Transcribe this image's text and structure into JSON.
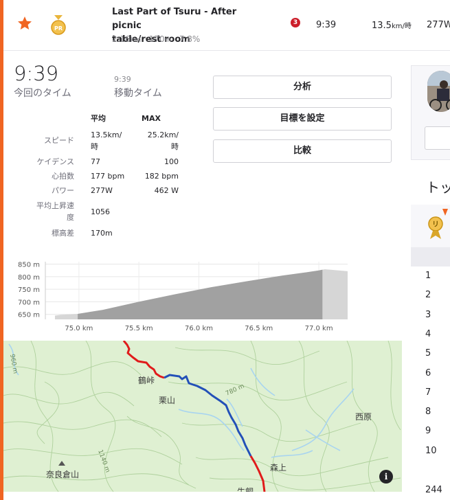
{
  "segment": {
    "name_line1": "Last Part of Tsuru - After picnic",
    "name_line2": "table/rest room",
    "distance": "2.16",
    "distance_unit": "km",
    "elev": "170",
    "elev_unit": "m",
    "grade": "7.8%",
    "rank": "3",
    "time": "9:39",
    "speed": "13.5",
    "speed_unit": "km/時",
    "power": "277W"
  },
  "summary": {
    "time": "9:39",
    "time_label": "今回のタイム",
    "moving_time": "9:39",
    "moving_time_label": "移動タイム"
  },
  "buttons": {
    "analyze": "分析",
    "goal": "目標を設定",
    "compare": "比較"
  },
  "stats": {
    "header_avg": "平均",
    "header_max": "MAX",
    "speed_label": "スピード",
    "speed_avg_1": "13.5km/",
    "speed_avg_2": "時",
    "speed_max_1": "25.2km/",
    "speed_max_2": "時",
    "cadence_label": "ケイデンス",
    "cadence_avg": "77",
    "cadence_max": "100",
    "hr_label": "心拍数",
    "hr_avg": "177 bpm",
    "hr_max": "182 bpm",
    "power_label": "パワー",
    "power_avg": "277W",
    "power_max": "462 W",
    "vam_label_1": "平均上昇速",
    "vam_label_2": "度",
    "vam_avg": "1056",
    "elev_label": "標高差",
    "elev_avg": "170m"
  },
  "elevation_chart": {
    "y_ticks": [
      "850 m",
      "800 m",
      "750 m",
      "700 m",
      "650 m"
    ],
    "x_ticks": [
      "75.0 km",
      "75.5 km",
      "76.0 km",
      "76.5 km",
      "77.0 km"
    ]
  },
  "chart_data": {
    "type": "area",
    "x": [
      74.8,
      74.85,
      74.99,
      75.2,
      75.5,
      75.8,
      76.1,
      76.4,
      76.7,
      76.9,
      77.0,
      77.05
    ],
    "y": [
      645,
      648,
      652,
      668,
      700,
      730,
      758,
      782,
      805,
      818,
      825,
      830
    ],
    "highlight_range": [
      74.99,
      77.03
    ],
    "ylim": [
      630,
      860
    ],
    "xlim": [
      74.72,
      77.24
    ],
    "xlabel": "",
    "ylabel": "",
    "grid": true,
    "colors": {
      "fill": "#bdbdbd",
      "highlight": "#8f8f8f"
    }
  },
  "map": {
    "labels": {
      "pass": "鶴峠",
      "kuriyama": "栗山",
      "nishihara": "西原",
      "morikami": "森上",
      "narakurayama": "奈良倉山",
      "contour_780": "780 m",
      "contour_1140": "1140 m",
      "contour_960": "960 m",
      "bottom": "牛飼"
    },
    "info_icon": "i",
    "colors": {
      "route_red": "#e01b1b",
      "route_blue": "#2350b8",
      "terrain": "#dff0d2",
      "water": "#a8d4f0"
    }
  },
  "sidebar": {
    "title": "トッ",
    "ranks": [
      "1",
      "2",
      "3",
      "4",
      "5",
      "6",
      "7",
      "8",
      "9",
      "10"
    ],
    "note": "244"
  },
  "colors": {
    "accent": "#f06522",
    "rank_badge": "#cc1e2a",
    "star": "#f06522"
  }
}
